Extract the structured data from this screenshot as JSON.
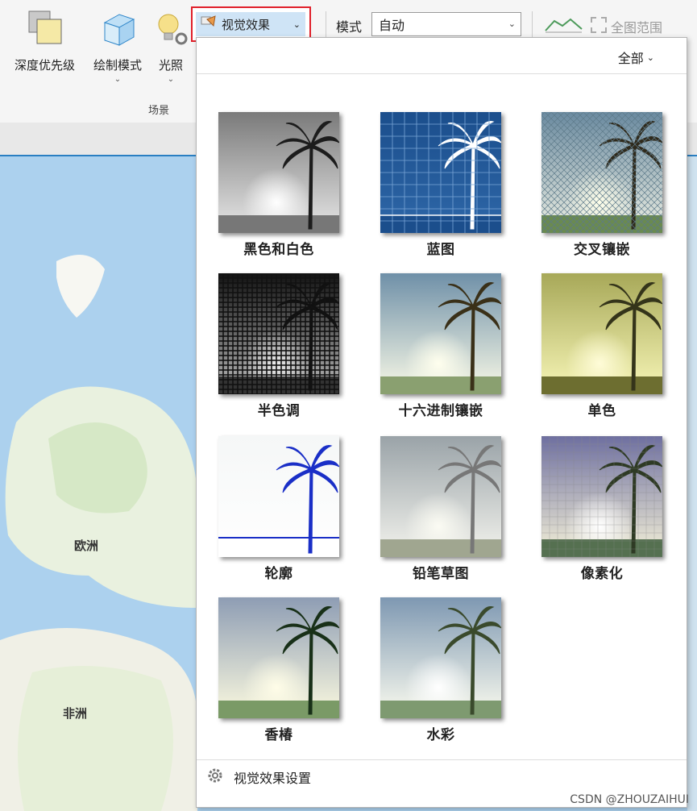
{
  "ribbon": {
    "buttons": [
      {
        "label": "深度优先级",
        "icon": "depth-priority-icon"
      },
      {
        "label": "绘制模式",
        "icon": "draw-mode-icon"
      },
      {
        "label": "光照",
        "icon": "lighting-icon"
      }
    ],
    "group_label": "场景",
    "visual_effects_label": "视觉效果",
    "mode_label": "模式",
    "mode_value": "自动",
    "full_extent_label": "全图范围"
  },
  "dropdown": {
    "filter_label": "全部",
    "effects": [
      {
        "label": "黑色和白色",
        "style": "bw"
      },
      {
        "label": "蓝图",
        "style": "blueprint"
      },
      {
        "label": "交叉镶嵌",
        "style": "crosshatch"
      },
      {
        "label": "半色调",
        "style": "halftone"
      },
      {
        "label": "十六进制镶嵌",
        "style": "hex"
      },
      {
        "label": "单色",
        "style": "mono"
      },
      {
        "label": "轮廓",
        "style": "outline"
      },
      {
        "label": "铅笔草图",
        "style": "pencil"
      },
      {
        "label": "像素化",
        "style": "pixel"
      },
      {
        "label": "香椿",
        "style": "toon"
      },
      {
        "label": "水彩",
        "style": "watercolor"
      }
    ],
    "settings_label": "视觉效果设置"
  },
  "map": {
    "labels": [
      "欧洲",
      "非洲"
    ]
  },
  "watermark": "CSDN @ZHOUZAIHUI"
}
